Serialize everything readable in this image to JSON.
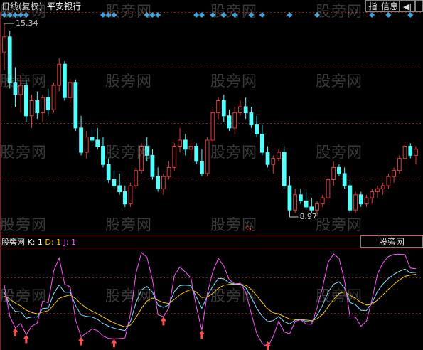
{
  "header": {
    "period": "日线(复权)",
    "stock_name": "平安银行"
  },
  "toolbar": {
    "indicator_btn": "指",
    "info_btn": "信息",
    "nav_btn": "◀|"
  },
  "price_marks": {
    "high": "15.34",
    "low": "8.97"
  },
  "badge": "G",
  "indicator": {
    "name": "股旁网",
    "k": "K: 1",
    "d": "D: 1",
    "j": "J: 1",
    "tab_label": "股旁网"
  },
  "watermark": "股旁网",
  "colors": {
    "up": "#e03c3c",
    "down": "#54ffff",
    "k_line": "#e0e0e0",
    "d_line": "#ffcc00",
    "j_line": "#ff55ff",
    "grid": "#8b1a1a",
    "signal_arrow": "#ff5050",
    "diamond": "#3aa6e0"
  },
  "chart_data": {
    "type": "candlestick",
    "price_high": 15.34,
    "price_low": 8.97,
    "candles": [
      [
        14.4,
        15.34,
        13.8,
        14.9
      ],
      [
        14.9,
        15.1,
        13.2,
        13.4
      ],
      [
        13.4,
        13.9,
        12.6,
        13.0
      ],
      [
        13.0,
        13.6,
        12.4,
        13.3
      ],
      [
        13.3,
        13.5,
        12.1,
        12.3
      ],
      [
        12.3,
        13.0,
        11.9,
        12.8
      ],
      [
        12.8,
        13.1,
        12.2,
        12.4
      ],
      [
        12.4,
        13.0,
        12.1,
        12.9
      ],
      [
        12.9,
        13.2,
        12.3,
        12.5
      ],
      [
        12.5,
        13.4,
        12.4,
        13.3
      ],
      [
        13.3,
        14.2,
        13.1,
        14.0
      ],
      [
        14.0,
        14.1,
        12.8,
        12.9
      ],
      [
        12.9,
        13.5,
        12.7,
        13.4
      ],
      [
        13.4,
        13.5,
        11.8,
        11.9
      ],
      [
        11.9,
        12.3,
        11.0,
        11.1
      ],
      [
        11.1,
        11.8,
        10.9,
        11.6
      ],
      [
        11.6,
        11.9,
        11.4,
        11.5
      ],
      [
        11.5,
        11.9,
        11.2,
        11.3
      ],
      [
        11.3,
        11.6,
        10.6,
        10.7
      ],
      [
        10.7,
        10.9,
        10.1,
        10.2
      ],
      [
        10.2,
        10.5,
        9.9,
        10.0
      ],
      [
        10.0,
        10.4,
        9.7,
        9.8
      ],
      [
        9.8,
        10.0,
        9.3,
        9.4
      ],
      [
        9.4,
        10.1,
        9.3,
        10.0
      ],
      [
        10.0,
        10.6,
        9.9,
        10.5
      ],
      [
        10.5,
        11.4,
        10.4,
        11.3
      ],
      [
        11.3,
        11.6,
        10.8,
        11.0
      ],
      [
        11.0,
        11.2,
        10.2,
        10.3
      ],
      [
        10.3,
        10.6,
        9.8,
        9.9
      ],
      [
        9.9,
        10.4,
        9.7,
        10.3
      ],
      [
        10.3,
        10.8,
        10.2,
        10.6
      ],
      [
        10.6,
        11.4,
        10.5,
        11.3
      ],
      [
        11.3,
        11.9,
        11.1,
        11.5
      ],
      [
        11.5,
        11.7,
        11.0,
        11.2
      ],
      [
        11.2,
        11.5,
        10.8,
        11.3
      ],
      [
        11.3,
        11.4,
        10.7,
        10.8
      ],
      [
        10.8,
        11.2,
        10.3,
        10.4
      ],
      [
        10.4,
        11.6,
        10.3,
        11.5
      ],
      [
        11.5,
        12.6,
        11.3,
        12.4
      ],
      [
        12.4,
        12.9,
        12.2,
        12.8
      ],
      [
        12.8,
        13.0,
        12.1,
        12.3
      ],
      [
        12.3,
        12.5,
        11.8,
        11.9
      ],
      [
        11.9,
        12.6,
        11.7,
        12.4
      ],
      [
        12.4,
        12.8,
        12.3,
        12.6
      ],
      [
        12.6,
        12.9,
        12.2,
        12.4
      ],
      [
        12.4,
        12.6,
        11.9,
        12.0
      ],
      [
        12.0,
        12.3,
        11.6,
        11.7
      ],
      [
        11.7,
        12.0,
        11.0,
        11.1
      ],
      [
        11.1,
        11.3,
        10.6,
        10.7
      ],
      [
        10.7,
        11.0,
        10.4,
        10.9
      ],
      [
        10.9,
        11.2,
        10.8,
        11.1
      ],
      [
        11.1,
        11.3,
        9.9,
        10.0
      ],
      [
        10.0,
        10.3,
        8.97,
        9.2
      ],
      [
        9.2,
        9.9,
        9.1,
        9.7
      ],
      [
        9.7,
        9.9,
        9.4,
        9.5
      ],
      [
        9.5,
        9.8,
        9.2,
        9.3
      ],
      [
        9.3,
        9.6,
        9.1,
        9.2
      ],
      [
        9.2,
        9.5,
        9.0,
        9.4
      ],
      [
        9.4,
        9.7,
        9.3,
        9.6
      ],
      [
        9.6,
        10.3,
        9.5,
        10.2
      ],
      [
        10.2,
        10.8,
        10.0,
        10.6
      ],
      [
        10.6,
        10.7,
        10.3,
        10.4
      ],
      [
        10.4,
        10.6,
        9.9,
        10.0
      ],
      [
        10.0,
        10.2,
        9.1,
        9.2
      ],
      [
        9.2,
        9.8,
        9.1,
        9.7
      ],
      [
        9.7,
        9.8,
        9.3,
        9.4
      ],
      [
        9.4,
        9.7,
        9.3,
        9.6
      ],
      [
        9.6,
        9.9,
        9.4,
        9.8
      ],
      [
        9.8,
        10.0,
        9.6,
        9.9
      ],
      [
        9.9,
        10.1,
        9.7,
        10.0
      ],
      [
        10.0,
        10.4,
        9.9,
        10.3
      ],
      [
        10.3,
        10.6,
        10.1,
        10.5
      ],
      [
        10.5,
        11.0,
        10.4,
        10.9
      ],
      [
        10.9,
        11.4,
        10.8,
        11.3
      ],
      [
        11.3,
        11.4,
        10.9,
        11.0
      ],
      [
        11.0,
        11.3,
        10.7,
        11.2
      ]
    ],
    "signal_count": 7
  }
}
